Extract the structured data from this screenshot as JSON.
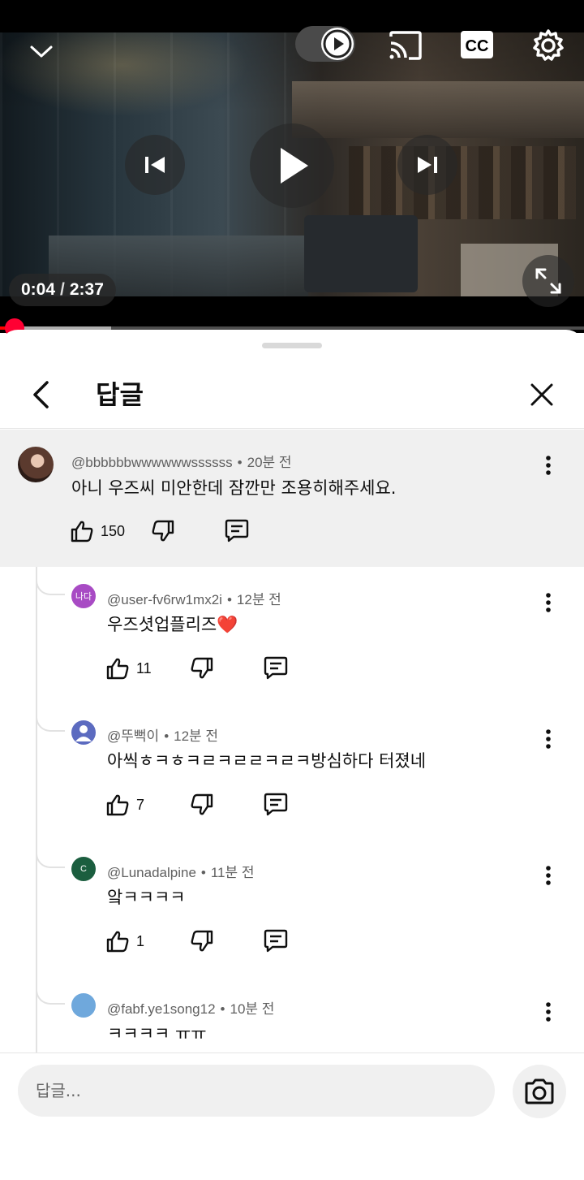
{
  "player": {
    "current_time": "0:04",
    "separator": "/",
    "duration": "2:37",
    "progress_fraction": 0.025,
    "buffered_fraction": 0.19,
    "accent_color": "#ff0033",
    "icons": {
      "collapse": "chevron-down-icon",
      "autoplay": "autoplay-toggle-icon",
      "cast": "cast-icon",
      "captions": "cc-icon",
      "settings": "gear-icon",
      "previous": "skip-previous-icon",
      "play": "play-icon",
      "next": "skip-next-icon",
      "fullscreen": "fullscreen-icon"
    }
  },
  "sheet": {
    "title": "답글",
    "icons": {
      "back": "back-arrow-icon",
      "close": "close-icon"
    }
  },
  "parent_comment": {
    "author": "@bbbbbbwwwwwwssssss",
    "time": "20분 전",
    "text": "아니 우즈씨 미안한데 잠깐만 조용히해주세요.",
    "likes": "150"
  },
  "replies": [
    {
      "author": "@user-fv6rw1mx2i",
      "time": "12분 전",
      "text": "우즈셧업플리즈❤️",
      "likes": "11",
      "avatar_initials": "나다",
      "avatar_color": "#a84bc4"
    },
    {
      "author": "@뚜뻑이",
      "time": "12분 전",
      "text": "아씩ㅎㅋㅎㅋㄹㅋㄹㄹㅋㄹㅋ방심하다 터졌네",
      "likes": "7",
      "avatar_initials": "",
      "avatar_color": "#5c6bc0"
    },
    {
      "author": "@Lunadalpine",
      "time": "11분 전",
      "text": "앜ㅋㅋㅋㅋ",
      "likes": "1",
      "avatar_initials": "C",
      "avatar_color": "#1b5e3f"
    },
    {
      "author": "@fabf.ye1song12",
      "time": "10분 전",
      "text": "ㅋㅋㅋㅋ ㅠㅠ",
      "likes": "",
      "avatar_initials": "",
      "avatar_color": "#6fa8dc"
    }
  ],
  "composer": {
    "placeholder": "답글...",
    "camera_icon": "camera-icon"
  }
}
